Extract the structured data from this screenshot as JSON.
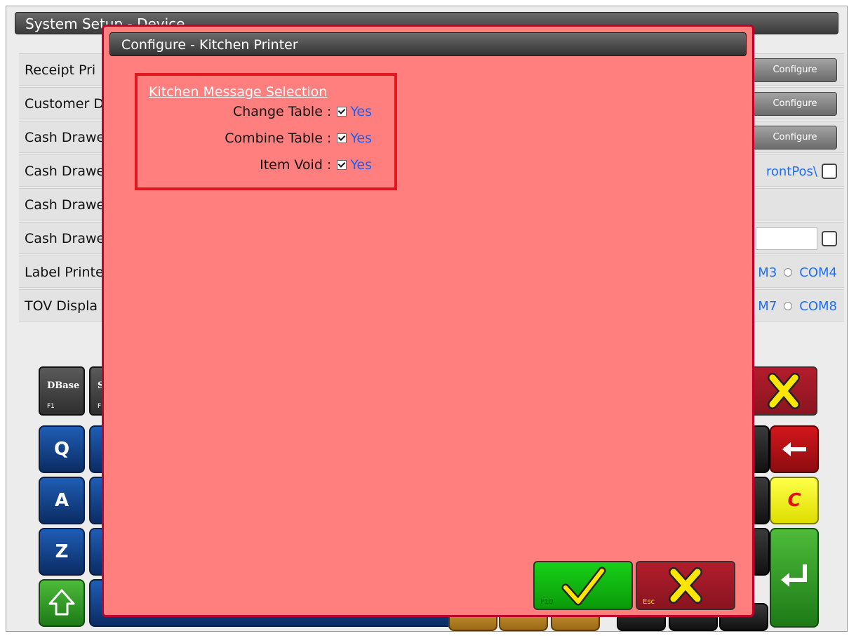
{
  "background": {
    "title": "System Setup - Device",
    "rows": [
      {
        "label": "Receipt Pri",
        "configure_label": "Configure"
      },
      {
        "label": "Customer D",
        "configure_label": "Configure"
      },
      {
        "label": "Cash Drawe",
        "configure_label": "Configure"
      },
      {
        "label": "Cash Drawe",
        "path_text": "rontPos\\"
      },
      {
        "label": "Cash Drawe"
      },
      {
        "label": "Cash Drawe"
      },
      {
        "label": "Label Printe",
        "com_a": "M3",
        "com_b": "COM4"
      },
      {
        "label": "TOV Displa",
        "com_a": "M7",
        "com_b": "COM8"
      }
    ],
    "function_keys": [
      {
        "label": "DBase",
        "hint": "F1"
      },
      {
        "label": "S",
        "hint": "F"
      }
    ],
    "keys": {
      "q": "Q",
      "a": "A",
      "z": "Z",
      "clear": "C"
    }
  },
  "dialog": {
    "title": "Configure - Kitchen Printer",
    "section_heading": "Kitchen Message Selection",
    "options": [
      {
        "label": "Change Table :",
        "checked": true,
        "value_label": "Yes"
      },
      {
        "label": "Combine Table :",
        "checked": true,
        "value_label": "Yes"
      },
      {
        "label": "Item Void :",
        "checked": true,
        "value_label": "Yes"
      }
    ],
    "ok_hint": "F10",
    "cancel_hint": "Esc"
  },
  "colors": {
    "dialog_background": "#ff7f7f",
    "highlight_border": "#e0171e",
    "ok_green": "#18d018",
    "cancel_red": "#b31d2c",
    "link_blue": "#1e5ff0"
  }
}
